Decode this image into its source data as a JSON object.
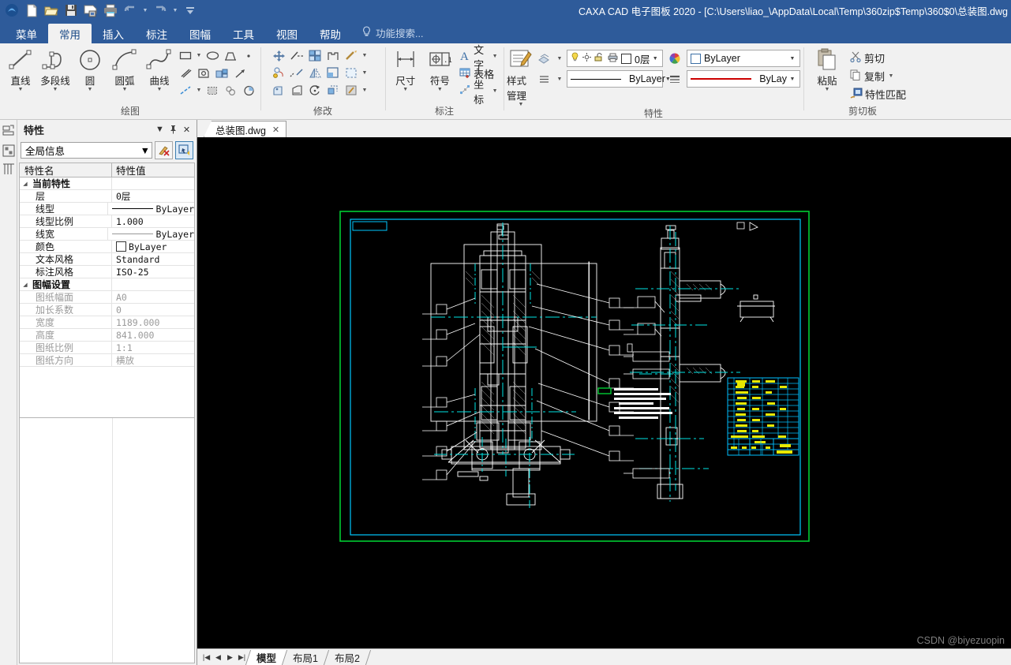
{
  "window": {
    "title": "CAXA CAD 电子图板 2020 - [C:\\Users\\liao_\\AppData\\Local\\Temp\\360zip$Temp\\360$0\\总装图.dwg",
    "accent": "#2e5b9a"
  },
  "quick_access": [
    {
      "name": "app-logo-icon",
      "label": "CAXA"
    },
    {
      "name": "new-file-icon",
      "label": "新建"
    },
    {
      "name": "open-file-icon",
      "label": "打开"
    },
    {
      "name": "save-icon",
      "label": "保存"
    },
    {
      "name": "save-as-icon",
      "label": "另存为"
    },
    {
      "name": "print-icon",
      "label": "打印"
    },
    {
      "name": "undo-icon",
      "label": "撤销"
    },
    {
      "name": "redo-icon",
      "label": "恢复"
    },
    {
      "name": "customize-qat-icon",
      "label": "自定义快速启动工具栏"
    }
  ],
  "menu": {
    "tabs": [
      {
        "label": "菜单",
        "active": false
      },
      {
        "label": "常用",
        "active": true
      },
      {
        "label": "插入",
        "active": false
      },
      {
        "label": "标注",
        "active": false
      },
      {
        "label": "图幅",
        "active": false
      },
      {
        "label": "工具",
        "active": false
      },
      {
        "label": "视图",
        "active": false
      },
      {
        "label": "帮助",
        "active": false
      }
    ],
    "search_placeholder": "功能搜索..."
  },
  "ribbon": {
    "groups": [
      {
        "label": "绘图",
        "big_buttons": [
          {
            "label": "直线",
            "icon": "line-icon"
          },
          {
            "label": "多段线",
            "icon": "polyline-icon"
          },
          {
            "label": "圆",
            "icon": "circle-icon"
          },
          {
            "label": "圆弧",
            "icon": "arc-icon"
          },
          {
            "label": "曲线",
            "icon": "spline-icon"
          }
        ],
        "small_icons": [
          "rectangle-icon",
          "ellipse-icon",
          "polygon-icon",
          "point-icon",
          "parallel-line-icon",
          "hatch-region-icon",
          "block-icon",
          "arrow-icon",
          "center-line-icon",
          "hatch-fill-icon",
          "puzzle-icon",
          "pie-fill-icon"
        ]
      },
      {
        "label": "修改",
        "small_icons": [
          "move-icon",
          "trim-icon",
          "array-icon",
          "extend-icon",
          "fillet-icon",
          "rotate-copy-icon",
          "break-icon",
          "mirror-icon",
          "offset-icon",
          "explode-icon",
          "stretch-icon",
          "chamfer-icon",
          "rotate-icon",
          "scale-icon",
          "edit-hatch-icon"
        ]
      },
      {
        "label": "标注",
        "big_buttons": [
          {
            "label": "尺寸",
            "icon": "dimension-icon"
          },
          {
            "label": "符号",
            "icon": "symbol-icon"
          }
        ],
        "text_buttons": [
          {
            "label": "文字",
            "icon": "text-icon",
            "caret": true
          },
          {
            "label": "表格",
            "icon": "table-icon",
            "caret": false
          },
          {
            "label": "坐标",
            "icon": "coordinate-icon",
            "caret": true
          }
        ]
      },
      {
        "label": "特性",
        "style_manager": {
          "label": "样式管理",
          "icon": "style-manager-icon"
        },
        "layer_combo": {
          "name": "layer-selector",
          "value": "0层",
          "icons": [
            "lightbulb-icon",
            "sun-icon",
            "unlock-icon",
            "printer-icon",
            "layer-color-icon"
          ]
        },
        "color_combo": {
          "name": "color-selector",
          "value": "ByLayer"
        },
        "linetype_combo": {
          "name": "linetype-selector",
          "value": "ByLayer"
        },
        "lineweight_combo": {
          "name": "lineweight-selector",
          "value": "ByLay"
        },
        "side_icons": [
          "layer-props-icon",
          "linetype-props-icon"
        ],
        "left_icons": [
          "color-wheel-icon",
          "lineweight-list-icon"
        ]
      },
      {
        "label": "剪切板",
        "paste": {
          "label": "粘贴",
          "icon": "paste-icon"
        },
        "items": [
          {
            "label": "剪切",
            "icon": "cut-icon",
            "caret": false
          },
          {
            "label": "复制",
            "icon": "copy-icon",
            "caret": true
          },
          {
            "label": "特性匹配",
            "icon": "match-properties-icon",
            "caret": false
          }
        ]
      }
    ]
  },
  "dock_strip": [
    "properties-tab-icon",
    "layer-tab-icon",
    "library-tab-icon"
  ],
  "properties_panel": {
    "title": "特性",
    "header_icons": [
      "chevron-down-icon",
      "pin-icon",
      "close-icon"
    ],
    "selector": {
      "name": "scope-selector",
      "value": "全局信息"
    },
    "tool_buttons": [
      "clear-selection-icon",
      "select-similar-icon"
    ],
    "columns": [
      "特性名",
      "特性值"
    ],
    "rows": [
      {
        "type": "group",
        "name": "当前特性"
      },
      {
        "type": "row",
        "name": "层",
        "value": "0层"
      },
      {
        "type": "row",
        "name": "线型",
        "value": "ByLayer",
        "render": "linetype"
      },
      {
        "type": "row",
        "name": "线型比例",
        "value": "1.000"
      },
      {
        "type": "row",
        "name": "线宽",
        "value": "ByLayer",
        "render": "lineweight"
      },
      {
        "type": "row",
        "name": "颜色",
        "value": "ByLayer",
        "render": "color"
      },
      {
        "type": "row",
        "name": "文本风格",
        "value": "Standard"
      },
      {
        "type": "row",
        "name": "标注风格",
        "value": "ISO-25"
      },
      {
        "type": "group",
        "name": "图幅设置"
      },
      {
        "type": "row",
        "name": "图纸幅面",
        "value": "A0",
        "dim": true
      },
      {
        "type": "row",
        "name": "加长系数",
        "value": "0",
        "dim": true
      },
      {
        "type": "row",
        "name": "宽度",
        "value": "1189.000",
        "dim": true
      },
      {
        "type": "row",
        "name": "高度",
        "value": "841.000",
        "dim": true
      },
      {
        "type": "row",
        "name": "图纸比例",
        "value": "1:1",
        "dim": true
      },
      {
        "type": "row",
        "name": "图纸方向",
        "value": "横放",
        "dim": true
      }
    ]
  },
  "document_tabs": [
    {
      "label": "总装图.dwg",
      "close": "✕",
      "active": true
    }
  ],
  "canvas": {
    "background": "#000000",
    "frame_outer_color": "#00cc33",
    "frame_inner_color": "#00c8ff",
    "geometry_color": "#ffffff",
    "centerline_color": "#00e5e5",
    "table_line_color": "#00bfff",
    "table_text_color": "#e8e800",
    "watermark": "CSDN @biyezuopin"
  },
  "layout_tabs": {
    "nav_buttons": [
      "first-icon",
      "prev-icon",
      "next-icon",
      "last-icon"
    ],
    "tabs": [
      {
        "label": "模型",
        "active": true
      },
      {
        "label": "布局1",
        "active": false
      },
      {
        "label": "布局2",
        "active": false
      }
    ]
  }
}
